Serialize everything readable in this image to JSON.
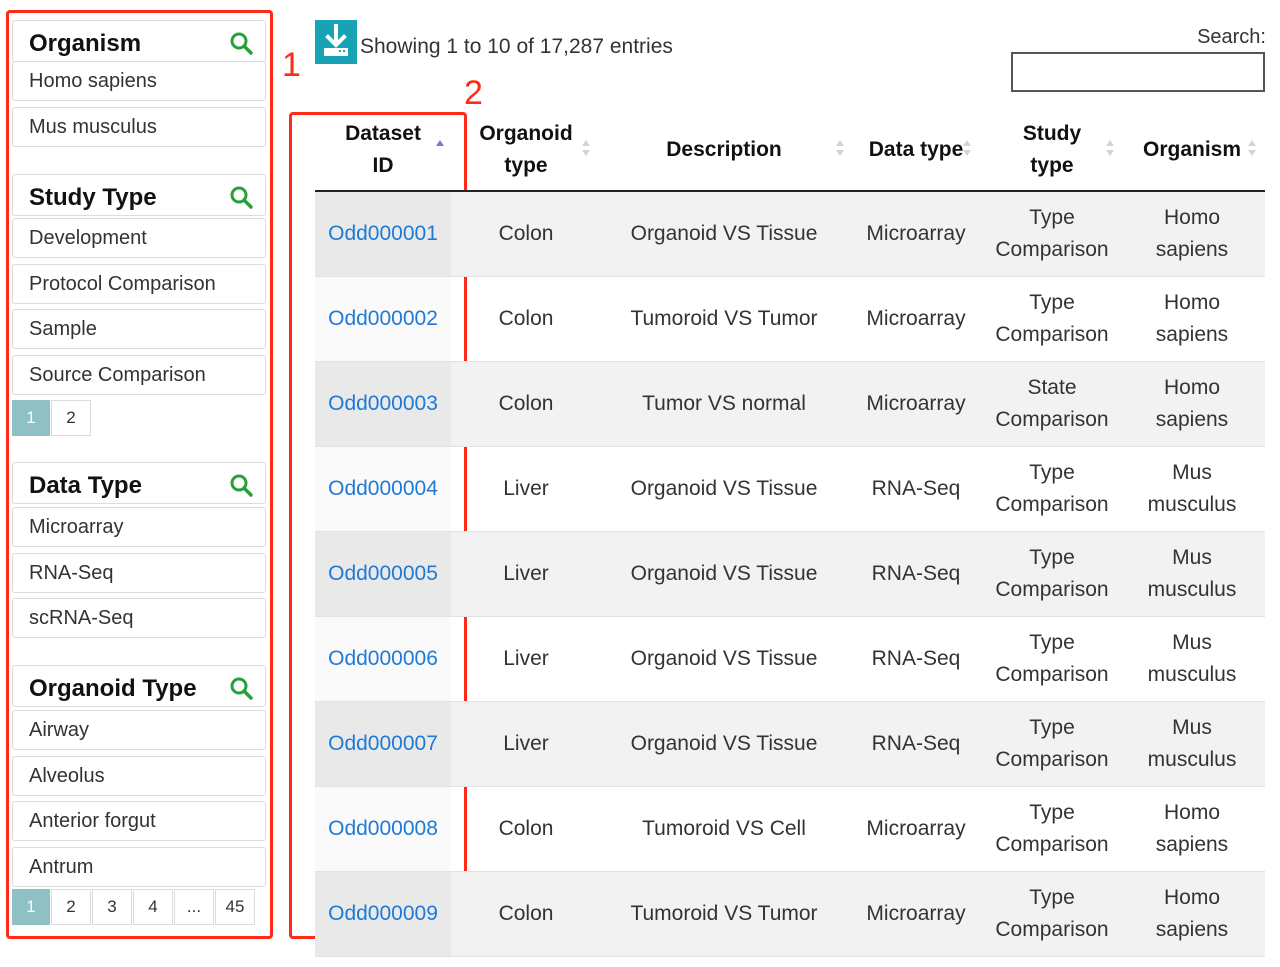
{
  "sidebar": {
    "facets": [
      {
        "title": "Organism",
        "items": [
          "Homo sapiens",
          "Mus musculus"
        ],
        "pagination": []
      },
      {
        "title": "Study Type",
        "items": [
          "Development",
          "Protocol Comparison",
          "Sample",
          "Source Comparison"
        ],
        "pagination": [
          "1",
          "2"
        ]
      },
      {
        "title": "Data Type",
        "items": [
          "Microarray",
          "RNA-Seq",
          "scRNA-Seq"
        ],
        "pagination": []
      },
      {
        "title": "Organoid Type",
        "items": [
          "Airway",
          "Alveolus",
          "Anterior forgut",
          "Antrum"
        ],
        "pagination": [
          "1",
          "2",
          "3",
          "4",
          "...",
          "45"
        ]
      }
    ]
  },
  "annotations": {
    "label_1": "1",
    "label_2": "2"
  },
  "toolbar": {
    "info": "Showing 1 to 10 of 17,287 entries",
    "search_label": "Search:",
    "search_value": ""
  },
  "table": {
    "columns": [
      {
        "label": "Dataset ID",
        "sort": "asc"
      },
      {
        "label": "Organoid type",
        "sort": "none"
      },
      {
        "label": "Description",
        "sort": "none"
      },
      {
        "label": "Data type",
        "sort": "none"
      },
      {
        "label": "Study type",
        "sort": "none"
      },
      {
        "label": "Organism",
        "sort": "none"
      }
    ],
    "rows": [
      [
        "Odd000001",
        "Colon",
        "Organoid VS Tissue",
        "Microarray",
        "Type Comparison",
        "Homo sapiens"
      ],
      [
        "Odd000002",
        "Colon",
        "Tumoroid VS Tumor",
        "Microarray",
        "Type Comparison",
        "Homo sapiens"
      ],
      [
        "Odd000003",
        "Colon",
        "Tumor VS normal",
        "Microarray",
        "State Comparison",
        "Homo sapiens"
      ],
      [
        "Odd000004",
        "Liver",
        "Organoid VS Tissue",
        "RNA-Seq",
        "Type Comparison",
        "Mus musculus"
      ],
      [
        "Odd000005",
        "Liver",
        "Organoid VS Tissue",
        "RNA-Seq",
        "Type Comparison",
        "Mus musculus"
      ],
      [
        "Odd000006",
        "Liver",
        "Organoid VS Tissue",
        "RNA-Seq",
        "Type Comparison",
        "Mus musculus"
      ],
      [
        "Odd000007",
        "Liver",
        "Organoid VS Tissue",
        "RNA-Seq",
        "Type Comparison",
        "Mus musculus"
      ],
      [
        "Odd000008",
        "Colon",
        "Tumoroid VS Cell",
        "Microarray",
        "Type Comparison",
        "Homo sapiens"
      ],
      [
        "Odd000009",
        "Colon",
        "Tumoroid VS Tumor",
        "Microarray",
        "Type Comparison",
        "Homo sapiens"
      ]
    ]
  },
  "colors": {
    "accent": "#18a3b4",
    "link": "#1e7ad6",
    "search_icon": "#27a03b",
    "annotation": "#ff2a1a",
    "page_active": "#8ec0c4"
  },
  "icons": {
    "download": "download-icon",
    "facet_search": "search-icon",
    "sort": "sort-icon"
  }
}
